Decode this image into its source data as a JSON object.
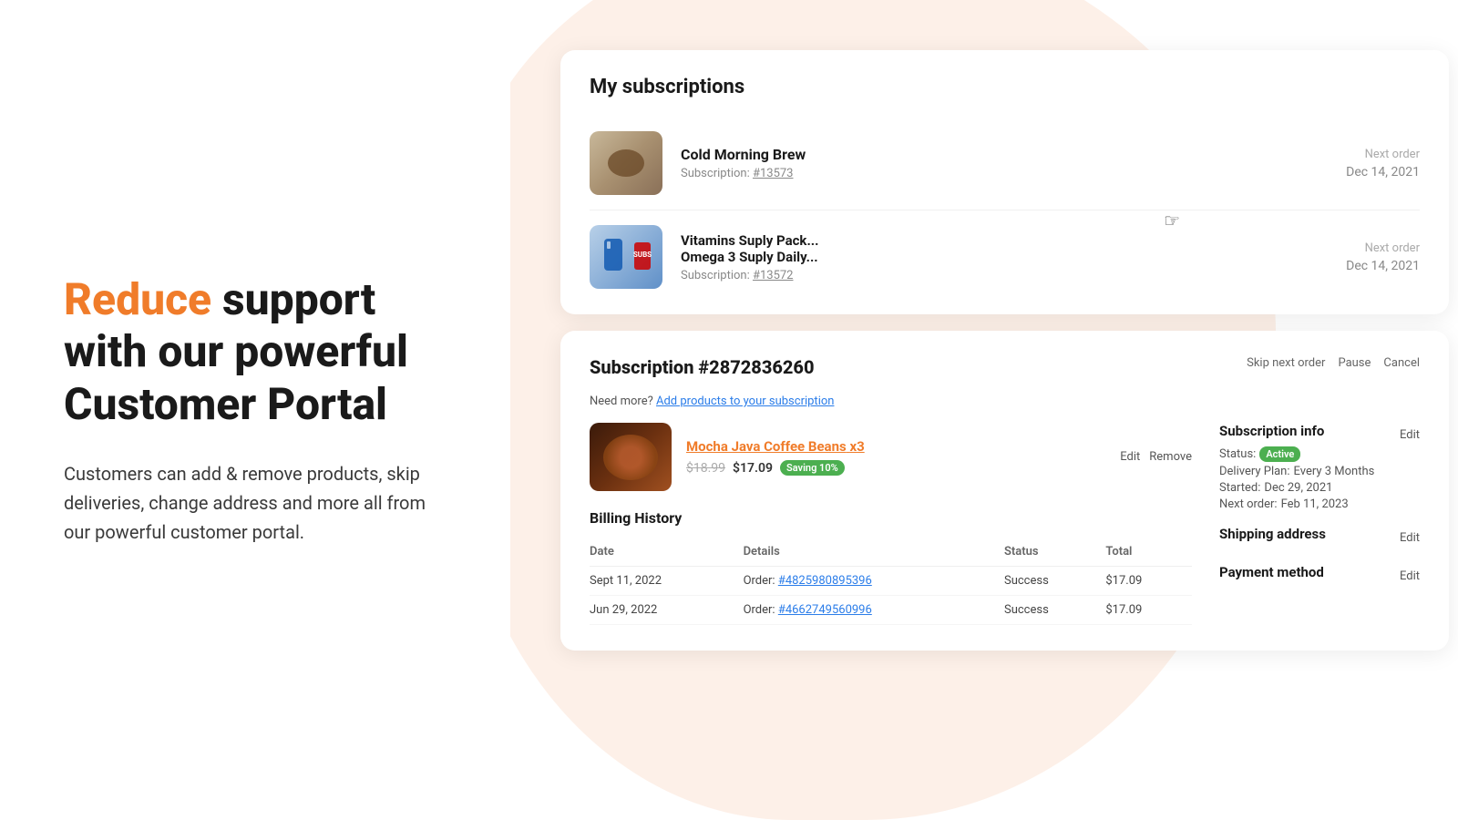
{
  "left": {
    "hero_title_highlight": "Reduce",
    "hero_title_rest": " support with our powerful Customer Portal",
    "hero_subtitle": "Customers can add & remove products, skip deliveries, change address and more all from our powerful customer portal."
  },
  "subscriptions_card": {
    "title": "My subscriptions",
    "items": [
      {
        "name": "Cold Morning Brew",
        "subscription_label": "Subscription: ",
        "subscription_id": "#13573",
        "next_order_label": "Next order",
        "next_order_date": "Dec 14, 2021"
      },
      {
        "name_line1": "Vitamins Suply Pack...",
        "name_line2": "Omega 3 Suply Daily...",
        "subscription_label": "Subscription: ",
        "subscription_id": "#13572",
        "next_order_label": "Next order",
        "next_order_date": "Dec 14, 2021"
      }
    ]
  },
  "detail_card": {
    "title": "Subscription #2872836260",
    "actions": {
      "skip": "Skip next order",
      "pause": "Pause",
      "cancel": "Cancel"
    },
    "add_products_text": "Need more?",
    "add_products_link": "Add products to your subscription",
    "product": {
      "name": "Mocha Java Coffee Beans",
      "quantity": "x3",
      "price_original": "$18.99",
      "price_current": "$17.09",
      "saving_badge": "Saving 10%",
      "edit_label": "Edit",
      "remove_label": "Remove"
    },
    "billing": {
      "title": "Billing History",
      "columns": [
        "Date",
        "Details",
        "Status",
        "Total"
      ],
      "rows": [
        {
          "date": "Sept 11, 2022",
          "details_text": "Order: ",
          "order_id": "#4825980895396",
          "status": "Success",
          "total": "$17.09"
        },
        {
          "date": "Jun 29, 2022",
          "details_text": "Order: ",
          "order_id": "#4662749560996",
          "status": "Success",
          "total": "$17.09"
        }
      ]
    },
    "subscription_info": {
      "title": "Subscription info",
      "status_label": "Status:",
      "status_value": "Active",
      "delivery_label": "Delivery Plan:",
      "delivery_value": "Every 3 Months",
      "started_label": "Started:",
      "started_value": "Dec 29, 2021",
      "next_order_label": "Next order:",
      "next_order_value": "Feb 11, 2023",
      "edit_label": "Edit"
    },
    "shipping_address": {
      "title": "Shipping address",
      "edit_label": "Edit"
    },
    "payment_method": {
      "title": "Payment method",
      "edit_label": "Edit"
    }
  }
}
